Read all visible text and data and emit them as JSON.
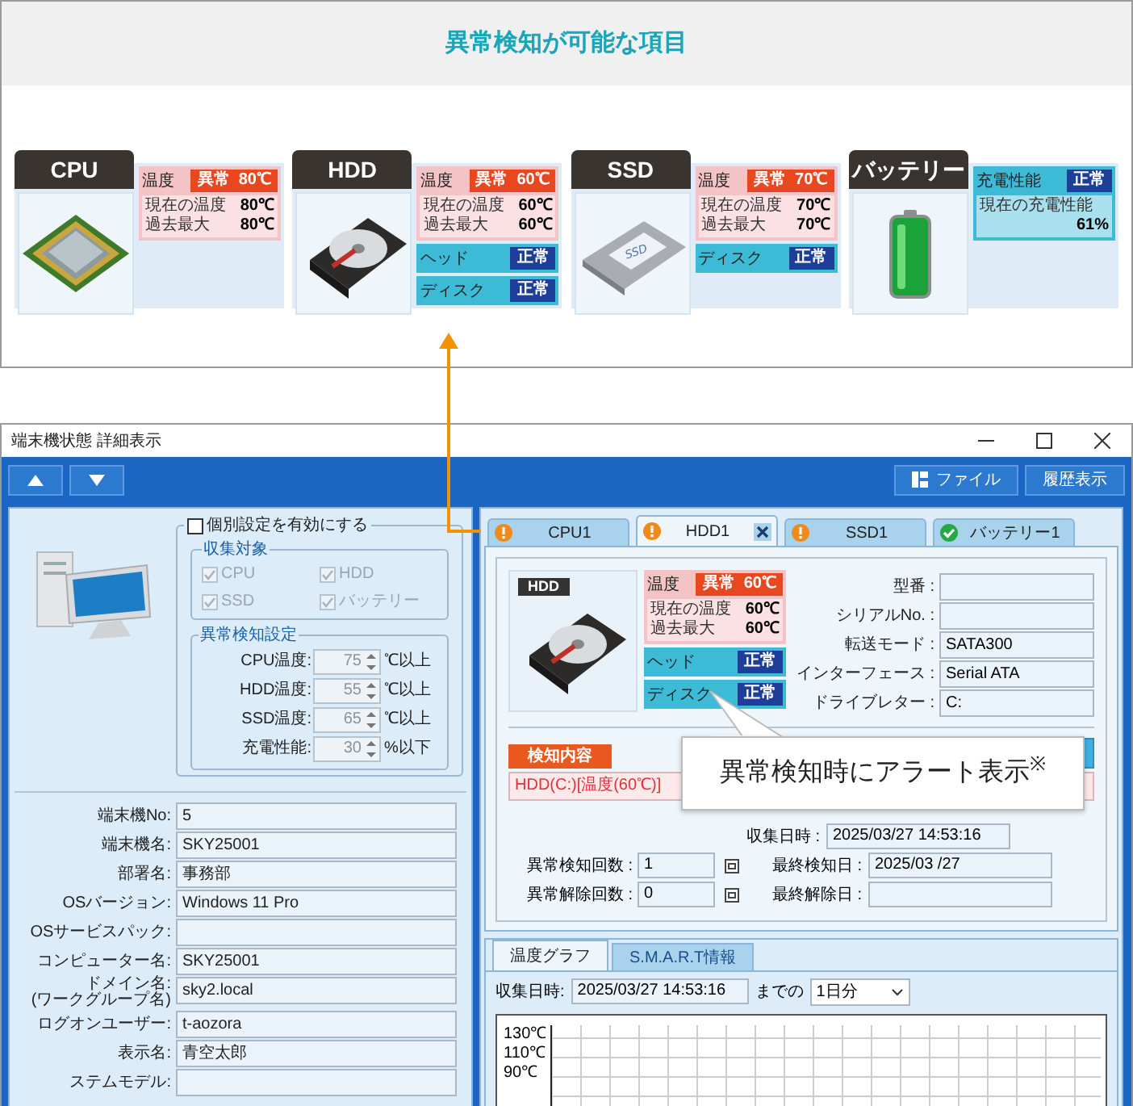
{
  "feature_panel": {
    "title": "異常検知が可能な項目",
    "cards": [
      {
        "title": "CPU",
        "kind": "cpu",
        "blocks": [
          {
            "kind": "temperature",
            "label": "温度",
            "status": "異常",
            "value": "80℃",
            "alert": true,
            "details": [
              {
                "label": "現在の温度",
                "value": "80℃"
              },
              {
                "label": "過去最大",
                "value": "80℃"
              }
            ]
          }
        ]
      },
      {
        "title": "HDD",
        "kind": "hdd",
        "blocks": [
          {
            "kind": "temperature",
            "label": "温度",
            "status": "異常",
            "value": "60℃",
            "alert": true,
            "details": [
              {
                "label": "現在の温度",
                "value": "60℃"
              },
              {
                "label": "過去最大",
                "value": "60℃"
              }
            ]
          },
          {
            "kind": "status",
            "label": "ヘッド",
            "status": "正常",
            "alert": false
          },
          {
            "kind": "status",
            "label": "ディスク",
            "status": "正常",
            "alert": false
          }
        ]
      },
      {
        "title": "SSD",
        "kind": "ssd",
        "device_text": "SSD",
        "blocks": [
          {
            "kind": "temperature",
            "label": "温度",
            "status": "異常",
            "value": "70℃",
            "alert": true,
            "details": [
              {
                "label": "現在の温度",
                "value": "70℃"
              },
              {
                "label": "過去最大",
                "value": "70℃"
              }
            ]
          },
          {
            "kind": "status",
            "label": "ディスク",
            "status": "正常",
            "alert": false
          }
        ]
      },
      {
        "title": "バッテリー",
        "kind": "battery",
        "blocks": [
          {
            "kind": "capacity",
            "label": "充電性能",
            "status": "正常",
            "alert": false,
            "details": [
              {
                "label": "現在の充電性能",
                "value": "61%"
              }
            ]
          }
        ]
      }
    ]
  },
  "window": {
    "title": "端末機状態 詳細表示",
    "toolbar_buttons": [
      {
        "label": "ファイル",
        "kind": "file"
      },
      {
        "label": "履歴表示",
        "kind": "plain"
      }
    ]
  },
  "settings": {
    "individual": {
      "label": "個別設定を有効にする",
      "checked": false
    },
    "collect": {
      "title": "収集対象",
      "items": [
        {
          "label": "CPU",
          "checked": true,
          "disabled": true
        },
        {
          "label": "HDD",
          "checked": true,
          "disabled": true
        },
        {
          "label": "SSD",
          "checked": true,
          "disabled": true
        },
        {
          "label": "バッテリー",
          "checked": true,
          "disabled": true
        }
      ]
    },
    "thresholds": {
      "title": "異常検知設定",
      "rows": [
        {
          "label": "CPU温度:",
          "value": "75",
          "unit": "℃以上",
          "disabled": true
        },
        {
          "label": "HDD温度:",
          "value": "55",
          "unit": "℃以上",
          "disabled": true
        },
        {
          "label": "SSD温度:",
          "value": "65",
          "unit": "℃以上",
          "disabled": true
        },
        {
          "label": "充電性能:",
          "value": "30",
          "unit": "%以下",
          "disabled": true
        }
      ]
    }
  },
  "info_rows": [
    {
      "label": "端末機No:",
      "value": "5"
    },
    {
      "label": "端末機名:",
      "value": "SKY25001"
    },
    {
      "label": "部署名:",
      "value": "事務部"
    },
    {
      "label": "OSバージョン:",
      "value": "Windows 11 Pro"
    },
    {
      "label": "OSサービスパック:"
    },
    {
      "label": "コンピューター名:",
      "value": "SKY25001"
    },
    {
      "label": "ドメイン名:\n(ワークグループ名)",
      "value": "sky2.local"
    },
    {
      "label": "ログオンユーザー:",
      "value": "t-aozora"
    },
    {
      "label": "表示名:",
      "value": "青空太郎"
    },
    {
      "label": "ステムモデル:"
    }
  ],
  "device_tabs": [
    {
      "label": "CPU1",
      "alert": true,
      "selected": false
    },
    {
      "label": "HDD1",
      "alert": true,
      "selected": true
    },
    {
      "label": "SSD1",
      "alert": true,
      "selected": false
    },
    {
      "label": "バッテリー1",
      "alert": false,
      "selected": false
    }
  ],
  "detail": {
    "badge": "HDD",
    "kind": "hdd",
    "blocks": [
      {
        "kind": "temperature",
        "label": "温度",
        "status": "異常",
        "value": "60℃",
        "alert": true,
        "details": [
          {
            "label": "現在の温度",
            "value": "60℃"
          },
          {
            "label": "過去最大",
            "value": "60℃"
          }
        ]
      },
      {
        "kind": "status",
        "label": "ヘッド",
        "status": "正常",
        "alert": false
      },
      {
        "kind": "status",
        "label": "ディスク",
        "status": "正常",
        "alert": false
      }
    ],
    "fields": [
      {
        "label": "型番 :"
      },
      {
        "label": "シリアルNo. :"
      },
      {
        "label": "転送モード :",
        "value": "SATA300"
      },
      {
        "label": "インターフェース :",
        "value": "Serial ATA"
      },
      {
        "label": "ドライブレター :",
        "value": "C:"
      }
    ],
    "detection": {
      "title": "検知内容",
      "text": "HDD(C:)[温度(60℃)]"
    },
    "callout": "異常検知時にアラート表示$^{※}$",
    "collected": {
      "label": "収集日時 :",
      "value": "2025/03/27 14:53:16"
    },
    "counts": [
      {
        "label": "異常検知回数 :",
        "value": "1",
        "date_label": "最終検知日 :",
        "date": "2025/03 /27"
      },
      {
        "label": "異常解除回数 :",
        "value": "0",
        "date_label": "最終解除日 :"
      }
    ]
  },
  "graph": {
    "tabs": [
      {
        "label": "温度グラフ",
        "selected": true
      },
      {
        "label": "S.M.A.R.T情報",
        "selected": false
      }
    ],
    "date_label": "収集日時:",
    "date_value": "2025/03/27 14:53:16",
    "range_label": "までの",
    "range_value": "1日分",
    "y_labels": [
      "130℃",
      "110℃",
      "90℃"
    ]
  }
}
